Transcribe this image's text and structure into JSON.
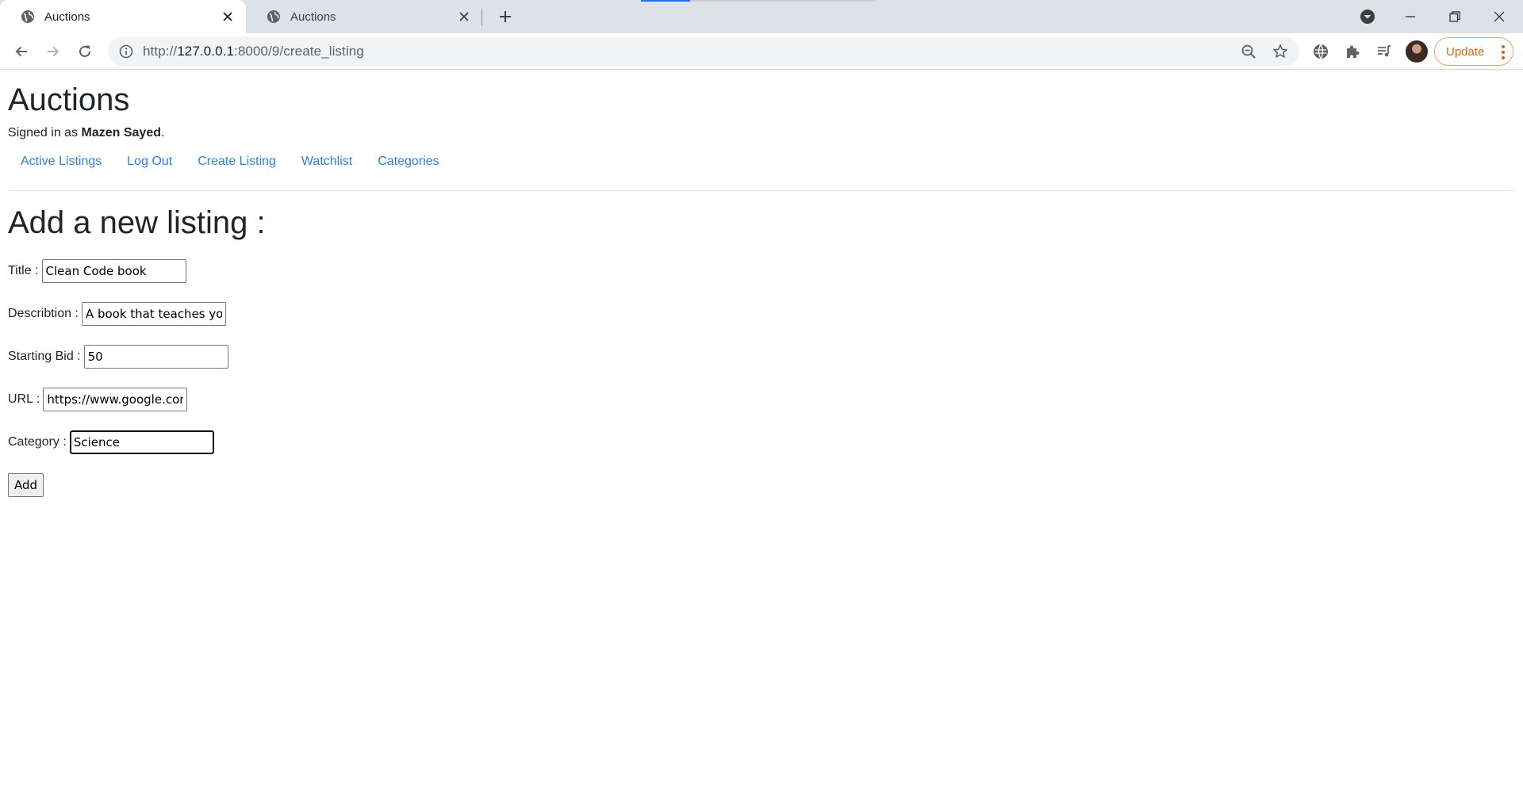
{
  "browser": {
    "tabs": [
      {
        "title": "Auctions",
        "active": true
      },
      {
        "title": "Auctions",
        "active": false
      }
    ],
    "url": {
      "scheme": "http://",
      "host": "127.0.0.1",
      "rest": ":8000/9/create_listing"
    },
    "update_label": "Update",
    "icons": {
      "back": "arrow-left-icon",
      "forward": "arrow-right-icon",
      "reload": "reload-icon",
      "info": "info-circle-icon",
      "zoom": "zoom-out-icon",
      "bookmark": "star-icon",
      "extensions": "puzzle-icon",
      "media": "media-queue-icon"
    },
    "accent_color": "#1a73e8",
    "update_color": "#c56b14"
  },
  "site": {
    "title": "Auctions",
    "signed_in_prefix": "Signed in as ",
    "user_name": "Mazen Sayed",
    "signed_in_suffix": ".",
    "nav": [
      {
        "label": "Active Listings"
      },
      {
        "label": "Log Out"
      },
      {
        "label": "Create Listing"
      },
      {
        "label": "Watchlist"
      },
      {
        "label": "Categories"
      }
    ],
    "link_color": "#2f80d9"
  },
  "form": {
    "heading": "Add a new listing :",
    "fields": {
      "title": {
        "label": "Title :",
        "value": "Clean Code book"
      },
      "description": {
        "label": "Describtion :",
        "value": "A book that teaches you"
      },
      "starting_bid": {
        "label": "Starting Bid :",
        "value": "50"
      },
      "url": {
        "label": "URL :",
        "value": "https://www.google.com"
      },
      "category": {
        "label": "Category :",
        "value": "Science"
      }
    },
    "submit_label": "Add"
  }
}
